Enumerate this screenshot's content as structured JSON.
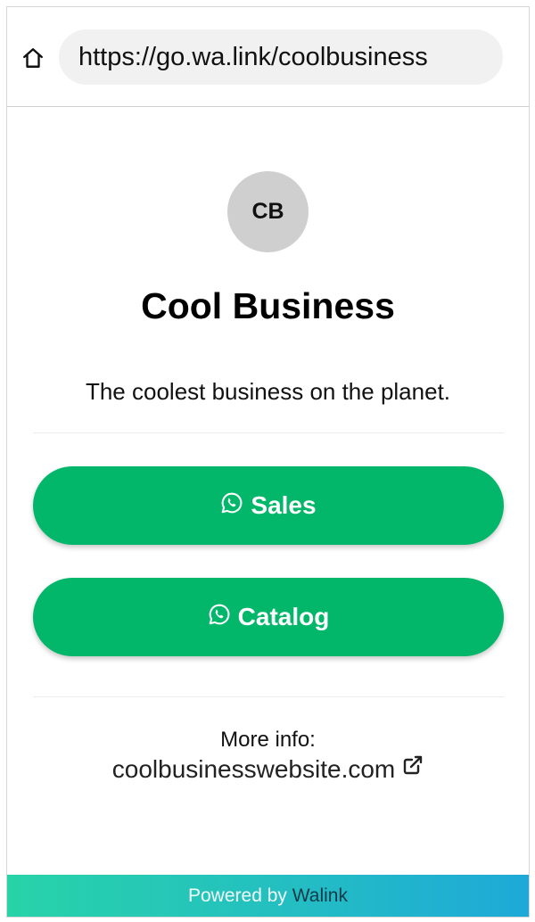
{
  "browser": {
    "url": "https://go.wa.link/coolbusiness",
    "home_icon": "home-icon"
  },
  "profile": {
    "initials": "CB",
    "name": "Cool Business",
    "tagline": "The coolest business on the planet."
  },
  "buttons": [
    {
      "label": "Sales",
      "icon": "whatsapp-icon"
    },
    {
      "label": "Catalog",
      "icon": "whatsapp-icon"
    }
  ],
  "more_info": {
    "label": "More info:",
    "website": "coolbusinesswebsite.com",
    "icon": "external-link-icon"
  },
  "footer": {
    "powered_by": "Powered by",
    "brand": "Walink"
  },
  "colors": {
    "button_green": "#02b76a",
    "avatar_gray": "#cfcfcf",
    "footer_gradient_start": "#28d3a8",
    "footer_gradient_end": "#1ea9d8"
  }
}
